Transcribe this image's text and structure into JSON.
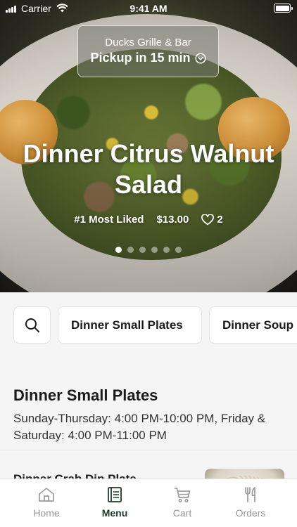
{
  "status_bar": {
    "carrier": "Carrier",
    "time": "9:41 AM",
    "icons": [
      "signal-icon",
      "wifi-icon",
      "battery-icon"
    ]
  },
  "venue": {
    "name": "Ducks Grille & Bar",
    "pickup": "Pickup in 15 min",
    "icon": "chevron-down-circle-icon"
  },
  "hero": {
    "title": "Dinner Citrus Walnut Salad",
    "rank": "#1 Most Liked",
    "price": "$13.00",
    "likes": "2",
    "likes_icon": "heart-icon",
    "carousel": {
      "total": 6,
      "active": 1
    }
  },
  "categories": {
    "search_icon": "search-icon",
    "items": [
      {
        "label": "Dinner Small Plates"
      },
      {
        "label": "Dinner Soup"
      }
    ]
  },
  "section": {
    "title": "Dinner Small Plates",
    "hours": "Sunday-Thursday: 4:00 PM-10:00 PM, Friday & Saturday: 4:00 PM-11:00 PM"
  },
  "menu_items": [
    {
      "name": "Dinner Crab Dip Plate"
    }
  ],
  "tab_bar": {
    "active": "Menu",
    "active_color": "#1f3d2a",
    "inactive_color": "#9a9a9a",
    "tabs": [
      {
        "label": "Home",
        "icon": "home-icon"
      },
      {
        "label": "Menu",
        "icon": "menu-book-icon"
      },
      {
        "label": "Cart",
        "icon": "cart-icon"
      },
      {
        "label": "Orders",
        "icon": "fork-knife-icon"
      }
    ]
  }
}
